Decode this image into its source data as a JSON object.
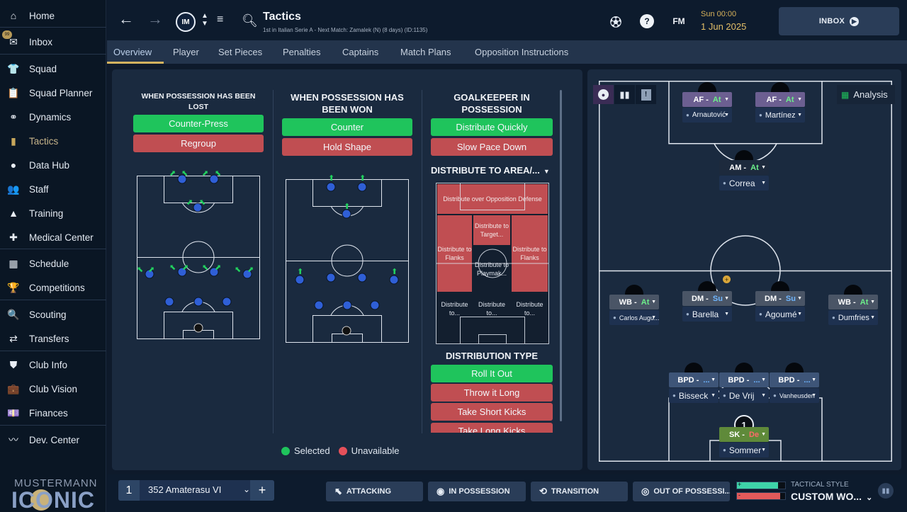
{
  "sidebar": {
    "items": [
      {
        "label": "Home",
        "icon": "home-icon",
        "glyph": "⌂"
      },
      {
        "label": "Inbox",
        "icon": "inbox-icon",
        "glyph": "✉"
      },
      {
        "label": "Squad",
        "icon": "squad-shirt-icon",
        "glyph": "👕"
      },
      {
        "label": "Squad Planner",
        "icon": "clipboard-icon",
        "glyph": "📋"
      },
      {
        "label": "Dynamics",
        "icon": "dynamics-icon",
        "glyph": "⚭"
      },
      {
        "label": "Tactics",
        "icon": "tactics-board-icon",
        "glyph": "▮"
      },
      {
        "label": "Data Hub",
        "icon": "data-hub-icon",
        "glyph": "●"
      },
      {
        "label": "Staff",
        "icon": "staff-icon",
        "glyph": "👥"
      },
      {
        "label": "Training",
        "icon": "training-cone-icon",
        "glyph": "▲"
      },
      {
        "label": "Medical Center",
        "icon": "medical-kit-icon",
        "glyph": "✚"
      },
      {
        "label": "Schedule",
        "icon": "calendar-icon",
        "glyph": "▦"
      },
      {
        "label": "Competitions",
        "icon": "trophy-icon",
        "glyph": "🏆"
      },
      {
        "label": "Scouting",
        "icon": "scouting-magnifier-icon",
        "glyph": "🔍"
      },
      {
        "label": "Transfers",
        "icon": "transfers-icon",
        "glyph": "⇄"
      },
      {
        "label": "Club Info",
        "icon": "club-shield-icon",
        "glyph": "⛊"
      },
      {
        "label": "Club Vision",
        "icon": "briefcase-icon",
        "glyph": "💼"
      },
      {
        "label": "Finances",
        "icon": "finances-icon",
        "glyph": "💷"
      },
      {
        "label": "Dev. Center",
        "icon": "dev-center-icon",
        "glyph": "〰"
      }
    ],
    "inbox_badge": "99"
  },
  "brand": {
    "line1": "MUSTERMANN",
    "line2": "ICONIC"
  },
  "topbar": {
    "title": "Tactics",
    "subtitle": "1st in Italian Serie A - Next Match: Zamalek (N) (8 days) (ID:1135)",
    "club_logo": "IM",
    "fm_label": "FM",
    "date_line1": "Sun 00:00",
    "date_line2": "1 Jun 2025",
    "inbox_label": "INBOX"
  },
  "tabs": [
    "Overview",
    "Player",
    "Set Pieces",
    "Penalties",
    "Captains",
    "Match Plans",
    "Opposition Instructions"
  ],
  "columns": {
    "lost": {
      "title": "WHEN POSSESSION HAS BEEN LOST",
      "options": [
        {
          "label": "Counter-Press",
          "state": "selected"
        },
        {
          "label": "Regroup",
          "state": "unavailable"
        }
      ]
    },
    "won": {
      "title": "WHEN POSSESSION HAS BEEN WON",
      "options": [
        {
          "label": "Counter",
          "state": "selected"
        },
        {
          "label": "Hold Shape",
          "state": "unavailable"
        }
      ]
    },
    "gk": {
      "title": "GOALKEEPER IN POSSESSION",
      "options": [
        {
          "label": "Distribute Quickly",
          "state": "selected"
        },
        {
          "label": "Slow Pace Down",
          "state": "unavailable"
        }
      ]
    }
  },
  "distribute_area": {
    "title": "DISTRIBUTE TO AREA/...",
    "cells": {
      "opposition": "Distribute over Opposition Defense",
      "target": "Distribute to Target...",
      "flank_left": "Distribute to Flanks",
      "flank_right": "Distribute to Flanks",
      "playmaker": "Distribute to Playmak...",
      "b1": "Distribute to...",
      "b2": "Distribute to...",
      "b3": "Distribute to..."
    }
  },
  "distribution_type": {
    "title": "DISTRIBUTION TYPE",
    "options": [
      {
        "label": "Roll It Out",
        "state": "selected"
      },
      {
        "label": "Throw it Long",
        "state": "unavailable"
      },
      {
        "label": "Take Short Kicks",
        "state": "unavailable"
      },
      {
        "label": "Take Long Kicks",
        "state": "unavailable"
      }
    ]
  },
  "legend": {
    "selected": "Selected",
    "unavailable": "Unavailable"
  },
  "colors": {
    "selected": "#1fc45c",
    "unavailable": "#c04e52",
    "accent_gold": "#d4b35f",
    "pitch_line": "#dfe5ee"
  },
  "analysis_label": "Analysis",
  "players": [
    {
      "role": "AF",
      "duty": "At",
      "name": "Arnautović",
      "color": "#6c5f91"
    },
    {
      "role": "AF",
      "duty": "At",
      "name": "Martínez",
      "color": "#6c5f91"
    },
    {
      "role": "AM",
      "duty": "At",
      "name": "Correa",
      "color": "#1d2a3d"
    },
    {
      "role": "WB",
      "duty": "At",
      "name": "Carlos Augu...",
      "color": "#4a5566"
    },
    {
      "role": "DM",
      "duty": "Su",
      "name": "Barella",
      "color": "#4a5566"
    },
    {
      "role": "DM",
      "duty": "Su",
      "name": "Agoumé",
      "color": "#4a5566"
    },
    {
      "role": "WB",
      "duty": "At",
      "name": "Dumfries",
      "color": "#4a5566"
    },
    {
      "role": "BPD",
      "duty": "...",
      "name": "Bisseck",
      "color": "#3e5578"
    },
    {
      "role": "BPD",
      "duty": "...",
      "name": "De Vrij",
      "color": "#3e5578"
    },
    {
      "role": "BPD",
      "duty": "...",
      "name": "Vanheusden",
      "color": "#3e5578"
    },
    {
      "role": "SK",
      "duty": "De",
      "name": "Sommer",
      "color": "#5f8a3a",
      "number": "1"
    }
  ],
  "bottom": {
    "tactic_number": "1",
    "tactic_name": "352 Amaterasu VI",
    "add": "+",
    "phases": [
      "ATTACKING",
      "IN POSSESSION",
      "TRANSITION",
      "OUT OF POSSESSI..."
    ],
    "style_label": "TACTICAL STYLE",
    "style_value": "CUSTOM WO...",
    "style_bar_positive": 0.85,
    "style_bar_negative": 0.9
  }
}
